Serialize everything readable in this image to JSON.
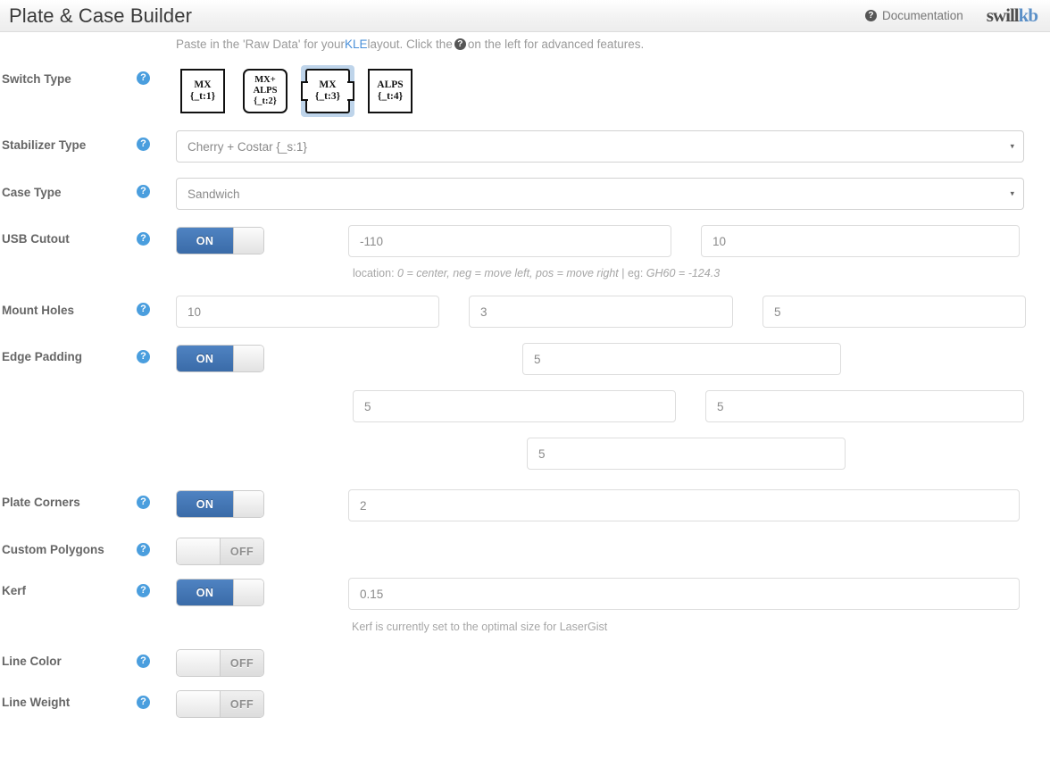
{
  "header": {
    "title": "Plate & Case Builder",
    "documentation_label": "Documentation",
    "doc_icon": "question-circle-icon",
    "logo_part1": "swill",
    "logo_part2": "kb",
    "accent_blue": "#4a9ede",
    "logo_blue": "#5a8fc7"
  },
  "subtitle": {
    "text_before_link": "Paste in the 'Raw Data' for your ",
    "link_label": "KLE",
    "text_after_link": " layout. Click the ",
    "icon": "question-circle-icon",
    "text_end": " on the left for advanced features."
  },
  "rows": {
    "switch_type": {
      "label": "Switch Type",
      "help_icon": "question-circle-icon",
      "options": [
        {
          "line1": "MX",
          "line2": "{_t:1}",
          "shape": "square",
          "selected": false
        },
        {
          "line1": "MX+",
          "line2": "ALPS",
          "line3": "{_t:2}",
          "shape": "rounded",
          "selected": false
        },
        {
          "line1": "MX",
          "line2": "{_t:3}",
          "shape": "notched",
          "selected": true
        },
        {
          "line1": "ALPS",
          "line2": "{_t:4}",
          "shape": "square",
          "selected": false
        }
      ]
    },
    "stabilizer_type": {
      "label": "Stabilizer Type",
      "help_icon": "question-circle-icon",
      "selected": "Cherry + Costar {_s:1}",
      "caret": "▾"
    },
    "case_type": {
      "label": "Case Type",
      "help_icon": "question-circle-icon",
      "selected": "Sandwich",
      "caret": "▾"
    },
    "usb_cutout": {
      "label": "USB Cutout",
      "help_icon": "question-circle-icon",
      "toggle_state": "ON",
      "toggle_on_label": "ON",
      "width_value": "-110",
      "radius_value": "10",
      "hint_prefix": "location: ",
      "hint_italic": "0 = center, neg = move left, pos = move right",
      "hint_mid": " | eg: ",
      "hint_italic2": "GH60 = -124.3"
    },
    "mount_holes": {
      "label": "Mount Holes",
      "help_icon": "question-circle-icon",
      "value1": "10",
      "value2": "3",
      "value3": "5"
    },
    "edge_padding": {
      "label": "Edge Padding",
      "help_icon": "question-circle-icon",
      "toggle_state": "ON",
      "toggle_on_label": "ON",
      "top": "5",
      "left": "5",
      "right": "5",
      "bottom": "5"
    },
    "plate_corners": {
      "label": "Plate Corners",
      "help_icon": "question-circle-icon",
      "toggle_state": "ON",
      "toggle_on_label": "ON",
      "value": "2"
    },
    "custom_polygons": {
      "label": "Custom Polygons",
      "help_icon": "question-circle-icon",
      "toggle_state": "OFF",
      "toggle_off_label": "OFF"
    },
    "kerf": {
      "label": "Kerf",
      "help_icon": "question-circle-icon",
      "toggle_state": "ON",
      "toggle_on_label": "ON",
      "value": "0.15",
      "hint": "Kerf is currently set to the optimal size for LaserGist"
    },
    "line_color": {
      "label": "Line Color",
      "help_icon": "question-circle-icon",
      "toggle_state": "OFF",
      "toggle_off_label": "OFF"
    },
    "line_weight": {
      "label": "Line Weight",
      "help_icon": "question-circle-icon",
      "toggle_state": "OFF",
      "toggle_off_label": "OFF"
    }
  }
}
